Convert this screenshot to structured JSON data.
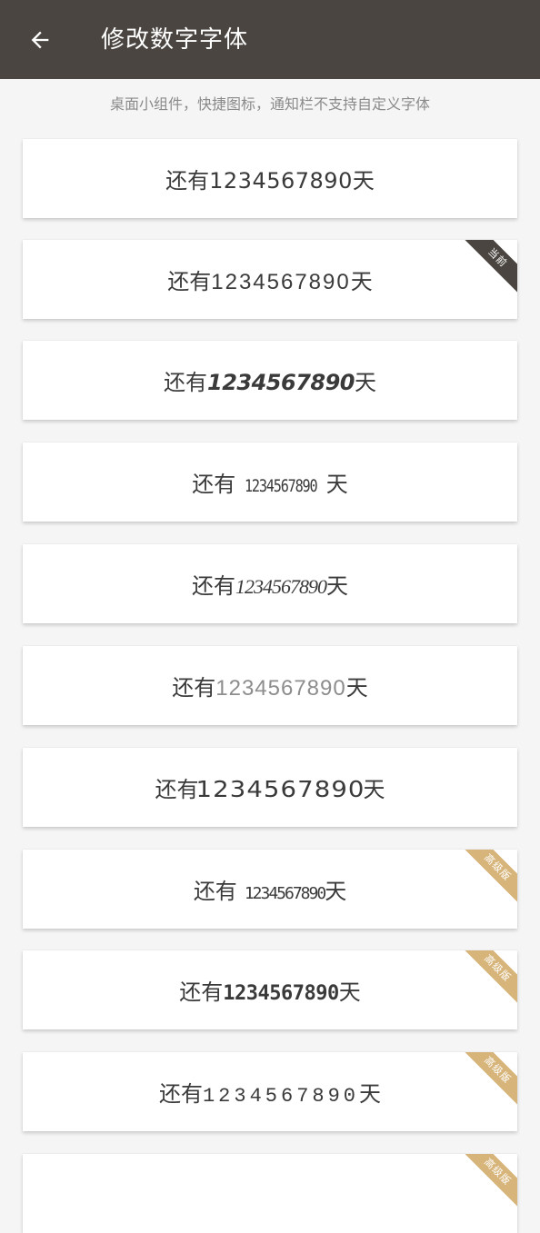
{
  "header": {
    "title": "修改数字字体",
    "back_icon": "arrow-left-icon",
    "background": "#4a4540"
  },
  "subtitle": "桌面小组件，快捷图标，通知栏不支持自定义字体",
  "badge_colors": {
    "current": "#4a4540",
    "premium": "#d6b47a"
  },
  "font_options": [
    {
      "prefix": "还有",
      "digits": "1234567890",
      "suffix": "天",
      "badge": ""
    },
    {
      "prefix": "还有",
      "digits": "1234567890",
      "suffix": "天",
      "badge": "当前"
    },
    {
      "prefix": "还有",
      "digits": "1234567890",
      "suffix": "天",
      "badge": ""
    },
    {
      "prefix": "还有",
      "digits": "1234567890",
      "suffix": "天",
      "badge": ""
    },
    {
      "prefix": "还有",
      "digits": "1234567890",
      "suffix": "天",
      "badge": ""
    },
    {
      "prefix": "还有",
      "digits": "1234567890",
      "suffix": "天",
      "badge": ""
    },
    {
      "prefix": "还有",
      "digits": "1234567890",
      "suffix": "天",
      "badge": ""
    },
    {
      "prefix": "还有",
      "digits": "1234567890",
      "suffix": "天",
      "badge": "高级版"
    },
    {
      "prefix": "还有",
      "digits": "1234567890",
      "suffix": "天",
      "badge": "高级版"
    },
    {
      "prefix": "还有",
      "digits": "1234567890",
      "suffix": "天",
      "badge": "高级版"
    },
    {
      "prefix": "",
      "digits": "",
      "suffix": "",
      "badge": "高级版"
    }
  ]
}
